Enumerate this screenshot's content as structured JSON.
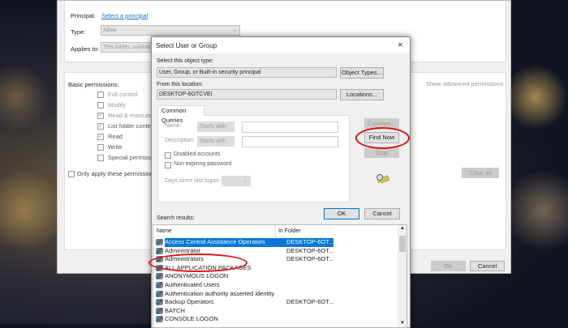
{
  "background_window": {
    "principal_label": "Principal:",
    "principal_link": "Select a principal",
    "type_label": "Type:",
    "type_value": "Allow",
    "applies_label": "Applies to:",
    "applies_value": "This folder, subfolders and files",
    "basic_permissions_label": "Basic permissions:",
    "show_advanced": "Show advanced permissions",
    "permissions": [
      {
        "label": "Full control",
        "checked": false
      },
      {
        "label": "Modify",
        "checked": false
      },
      {
        "label": "Read & execute",
        "checked": true
      },
      {
        "label": "List folder contents",
        "checked": true
      },
      {
        "label": "Read",
        "checked": true
      },
      {
        "label": "Write",
        "checked": false
      },
      {
        "label": "Special permissions",
        "checked": false
      }
    ],
    "only_apply": "Only apply these permissions to objects and/or containers within this container",
    "clear_all": "Clear all",
    "ok": "OK",
    "cancel": "Cancel"
  },
  "dialog": {
    "title": "Select User or Group",
    "close": "✕",
    "object_type_label": "Select this object type:",
    "object_type_value": "User, Group, or Built-in security principal",
    "object_types_button": "Object Types...",
    "location_label": "From this location:",
    "location_value": "DESKTOP-6OTCVEI",
    "locations_button": "Locations...",
    "tab": "Common Queries",
    "name_label": "Name:",
    "name_mode": "Starts with",
    "description_label": "Description:",
    "description_mode": "Starts with",
    "disabled_accounts": "Disabled accounts",
    "non_expiring": "Non expiring password",
    "days_label": "Days since last logon:",
    "columns_button": "Columns...",
    "find_now_button": "Find Now",
    "stop_button": "Stop",
    "ok": "OK",
    "cancel": "Cancel",
    "search_results_label": "Search results:",
    "col_name": "Name",
    "col_folder": "In Folder",
    "results": [
      {
        "name": "Access Control Assistance Operators",
        "folder": "DESKTOP-6OT..."
      },
      {
        "name": "Administrator",
        "folder": "DESKTOP-6OT..."
      },
      {
        "name": "Administrators",
        "folder": "DESKTOP-6OT..."
      },
      {
        "name": "ALL APPLICATION PACKAGES",
        "folder": ""
      },
      {
        "name": "ANONYMOUS LOGON",
        "folder": ""
      },
      {
        "name": "Authenticated Users",
        "folder": ""
      },
      {
        "name": "Authentication authority asserted identity",
        "folder": ""
      },
      {
        "name": "Backup Operators",
        "folder": "DESKTOP-6OT..."
      },
      {
        "name": "BATCH",
        "folder": ""
      },
      {
        "name": "CONSOLE LOGON",
        "folder": ""
      }
    ]
  }
}
